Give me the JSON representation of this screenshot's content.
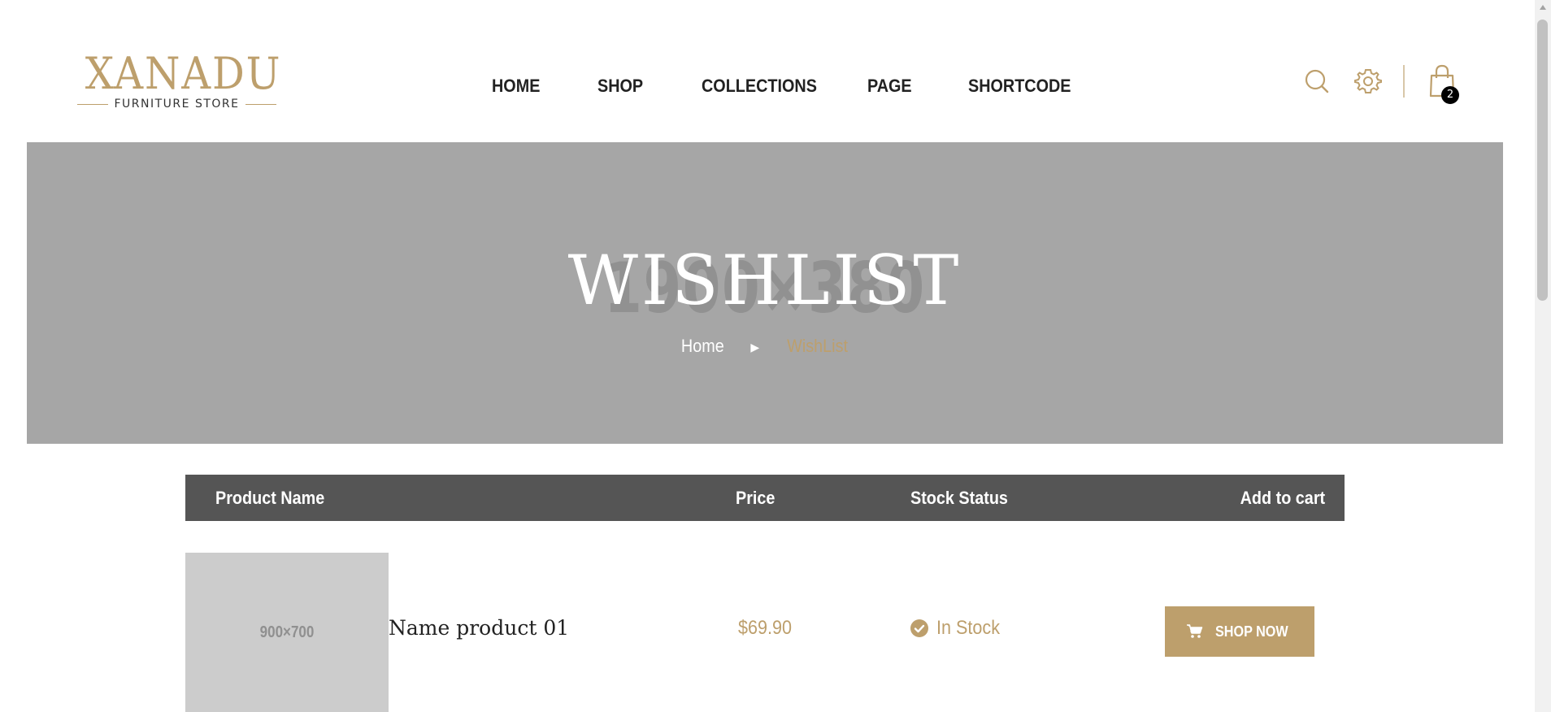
{
  "header": {
    "logo": {
      "name": "XANADU",
      "tagline": "FURNITURE STORE"
    },
    "nav": [
      "HOME",
      "SHOP",
      "COLLECTIONS",
      "PAGE",
      "SHORTCODE"
    ],
    "icons": {
      "search": "search-icon",
      "settings": "gear-icon",
      "cart": "shopping-bag-icon"
    },
    "cart_count": "2"
  },
  "hero": {
    "placeholder": "1900×380",
    "title": "WISHLIST",
    "breadcrumb": {
      "home": "Home",
      "current": "WishList"
    }
  },
  "table": {
    "headers": {
      "name": "Product Name",
      "price": "Price",
      "stock": "Stock Status",
      "cart": "Add to cart"
    },
    "rows": [
      {
        "image_placeholder": "900×700",
        "name": "Name product 01",
        "price": "$69.90",
        "stock": "In Stock",
        "button": "SHOP NOW"
      }
    ]
  },
  "colors": {
    "accent": "#bd9f6c",
    "hero_bg": "#a6a6a6",
    "table_head": "#555555",
    "placeholder_bg": "#cccccc"
  }
}
